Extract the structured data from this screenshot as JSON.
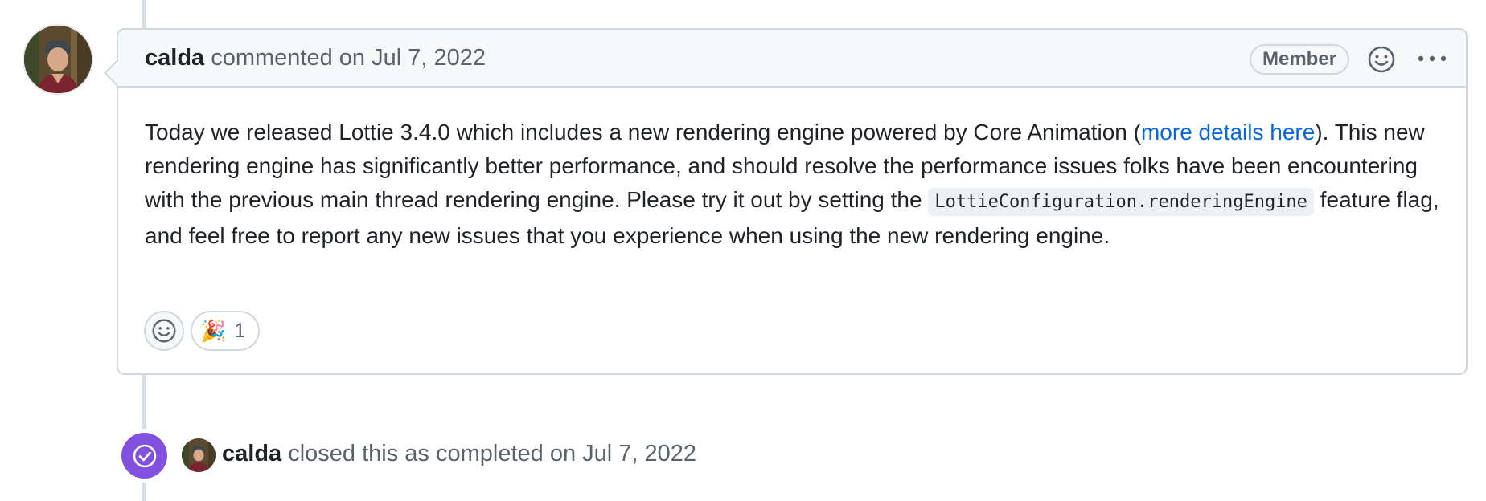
{
  "comment": {
    "author": "calda",
    "action_text": " commented on Jul 7, 2022",
    "badge": "Member",
    "icons": {
      "avatar": "avatar",
      "add_reaction": "smiley-icon",
      "more": "kebab-horizontal-icon"
    },
    "body": {
      "p1_before": "Today we released Lottie 3.4.0 which includes a new rendering engine powered by Core Animation (",
      "link_text": "more details here",
      "p1_after": "). This new rendering engine has significantly better performance, and should resolve the performance issues folks have been encountering with the previous main thread rendering engine. Please try it out by setting the ",
      "code": "LottieConfiguration.renderingEngine",
      "p1_end": " feature flag, and feel free to report any new issues that you experience when using the new rendering engine."
    },
    "reactions": [
      {
        "emoji": "🎉",
        "name": "tada-reaction",
        "count": "1"
      }
    ]
  },
  "event": {
    "icon": "check-circle-icon",
    "author": "calda",
    "text": " closed this as completed on Jul 7, 2022"
  },
  "colors": {
    "accent_link": "#0969da",
    "closed_purple": "#8250df",
    "border": "#d0d7de",
    "header_bg": "#f6f8fa",
    "muted_text": "#59636e"
  }
}
